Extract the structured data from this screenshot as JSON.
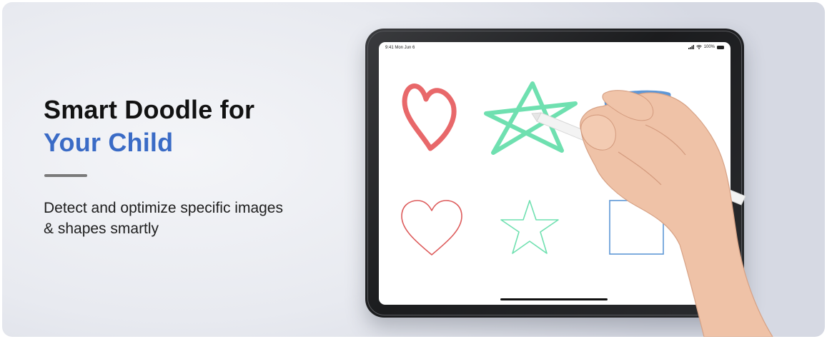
{
  "headline": {
    "line1": "Smart Doodle for",
    "line2": "Your Child"
  },
  "description": {
    "line1": "Detect and optimize specific images",
    "line2": "& shapes smartly"
  },
  "tablet_status": {
    "time": "9:41 Mon Jun 6",
    "battery": "100%"
  },
  "colors": {
    "accent": "#3a6bc6",
    "heart": "#e8686a",
    "star": "#6fe0b0",
    "square": "#5e97d6"
  },
  "icons": [
    "signal-icon",
    "wifi-icon",
    "battery-icon"
  ]
}
